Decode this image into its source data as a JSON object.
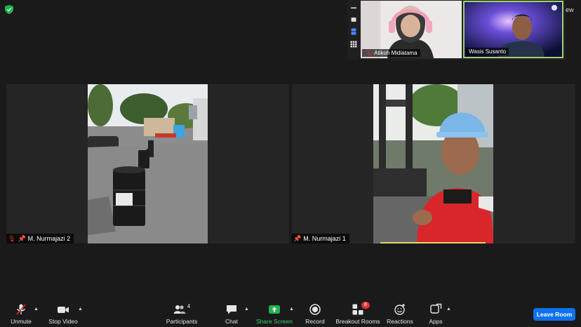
{
  "top": {
    "view_label": "ew"
  },
  "thumbnails": [
    {
      "name": "Atikoh Midiatama",
      "muted": true
    },
    {
      "name": "Wasis Susanto",
      "muted": false,
      "active_speaker": true
    }
  ],
  "tiles": [
    {
      "name": "M. Nurmajazi 2",
      "muted": true,
      "pinned": true
    },
    {
      "name": "M. Nurmajazi 1",
      "muted": false,
      "pinned": true
    }
  ],
  "toolbar": {
    "unmute": "Unmute",
    "stop_video": "Stop Video",
    "participants": "Participants",
    "participants_count": "4",
    "chat": "Chat",
    "share_screen": "Share Screen",
    "record": "Record",
    "breakout_rooms": "Breakout Rooms",
    "breakout_badge": "8",
    "reactions": "Reactions",
    "apps": "Apps",
    "leave_room": "Leave Room"
  },
  "colors": {
    "accent": "#0e72ed",
    "share": "#3cd070",
    "muted": "#e0312f",
    "speaker_border": "#9fd16e"
  }
}
